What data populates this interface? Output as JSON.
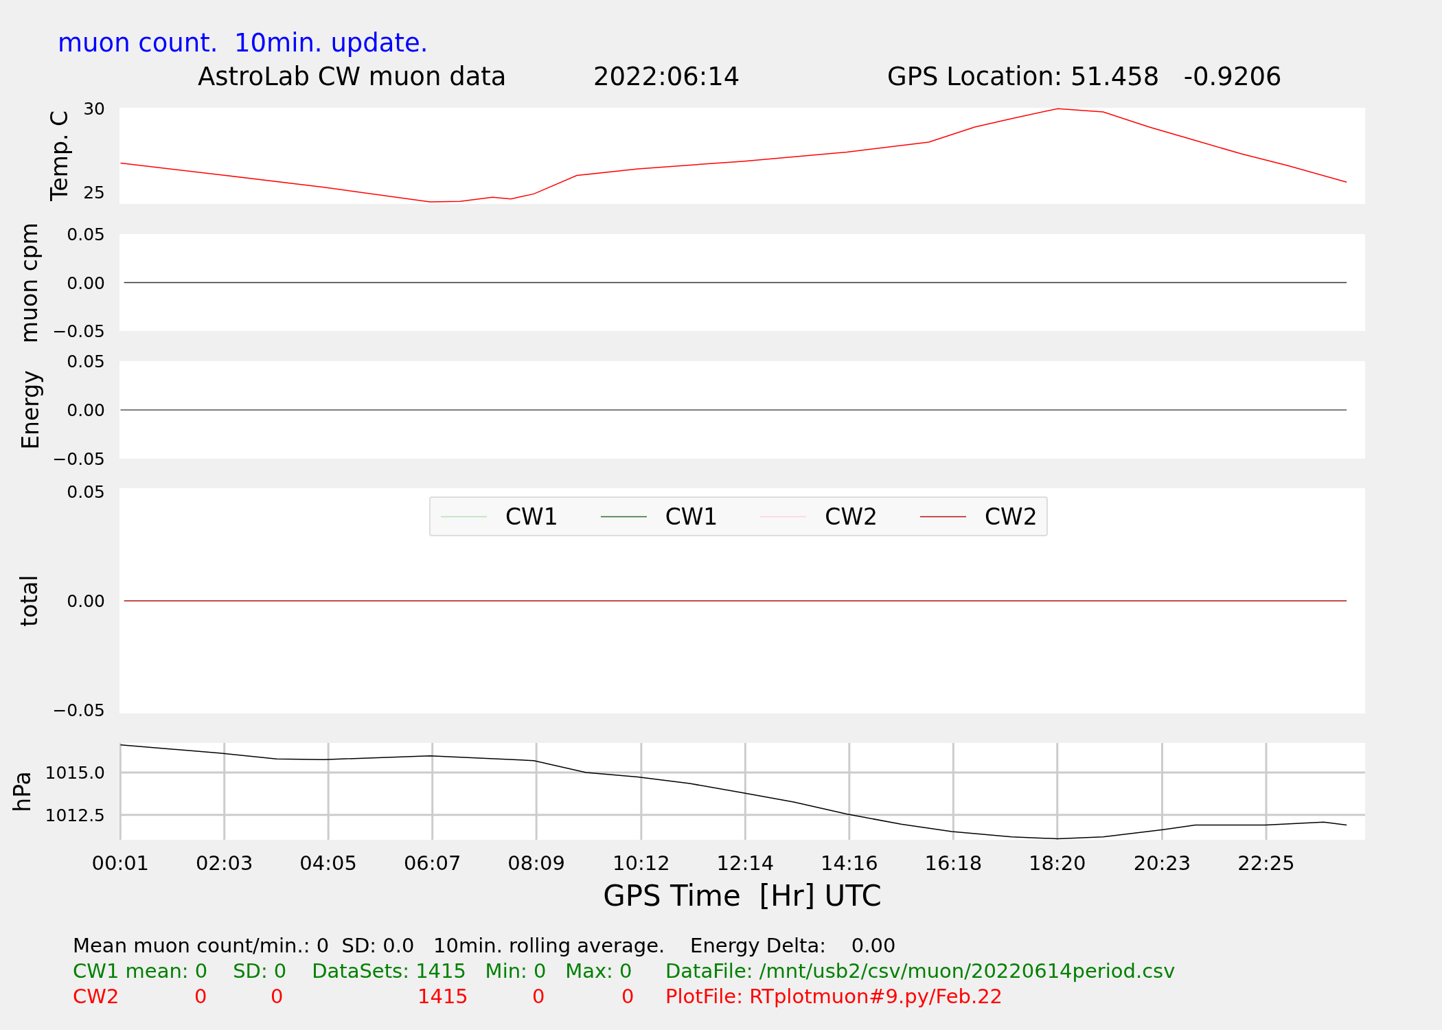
{
  "header": {
    "subtitle": "muon count.  10min. update.",
    "title": "AstroLab CW muon data",
    "date": "2022:06:14",
    "location": "GPS Location: 51.458   -0.9206"
  },
  "panels": [
    {
      "chart_data": {
        "type": "line",
        "ylabel": "Temp. C",
        "xlim": [
          0,
          24.35
        ],
        "ylim": [
          24.3,
          30.05
        ],
        "yticks": [
          {
            "value": 25,
            "label": "25"
          },
          {
            "value": 30,
            "label": "30"
          }
        ],
        "x": [
          0.02,
          1.96,
          4.0,
          6.07,
          6.66,
          7.29,
          7.65,
          8.1,
          8.94,
          10.13,
          12.18,
          14.22,
          15.82,
          16.72,
          17.44,
          18.34,
          19.23,
          20.13,
          21.03,
          21.93,
          22.83,
          23.99
        ],
        "series": [
          {
            "color": "#ff0000",
            "values": [
              26.74,
              26.05,
              25.3,
              24.42,
              24.45,
              24.7,
              24.6,
              24.9,
              26.0,
              26.4,
              26.85,
              27.4,
              28.0,
              28.9,
              29.4,
              30.0,
              29.8,
              28.9,
              28.1,
              27.3,
              26.6,
              25.6
            ]
          }
        ]
      }
    },
    {
      "chart_data": {
        "type": "line",
        "ylabel": "muon cpm",
        "xlim": [
          0,
          24.35
        ],
        "ylim": [
          -0.05,
          0.05
        ],
        "yticks": [
          {
            "value": 0.05,
            "label": "0.05"
          },
          {
            "value": 0,
            "label": "0.00"
          },
          {
            "value": -0.05,
            "label": "−0.05"
          }
        ],
        "x": [
          0.09,
          23.99
        ],
        "series": [
          {
            "color": "#333333",
            "values": [
              0,
              0
            ]
          }
        ]
      }
    },
    {
      "chart_data": {
        "type": "line",
        "ylabel": "Energy",
        "xlim": [
          0,
          24.35
        ],
        "ylim": [
          -0.05,
          0.05
        ],
        "yticks": [
          {
            "value": 0.05,
            "label": "0.05"
          },
          {
            "value": 0,
            "label": "0.00"
          },
          {
            "value": -0.05,
            "label": "−0.05"
          }
        ],
        "x": [
          0.02,
          23.99
        ],
        "series": [
          {
            "color": "#555555",
            "values": [
              0,
              0
            ]
          }
        ]
      }
    },
    {
      "chart_data": {
        "type": "line",
        "ylabel": "total",
        "xlim": [
          0,
          24.35
        ],
        "ylim": [
          -0.0515,
          0.0515
        ],
        "yticks": [
          {
            "value": 0.05,
            "label": "0.05"
          },
          {
            "value": 0,
            "label": "0.00"
          },
          {
            "value": -0.05,
            "label": "−0.05"
          }
        ],
        "x": [
          0.09,
          23.99
        ],
        "legend": true,
        "series": [
          {
            "name": "CW1",
            "color": "#b8ddb8",
            "values": [
              null,
              null
            ]
          },
          {
            "name": "CW1",
            "color": "#2e6b2e",
            "values": [
              null,
              null
            ]
          },
          {
            "name": "CW2",
            "color": "#ffd0d8",
            "values": [
              null,
              null
            ]
          },
          {
            "name": "CW2",
            "color": "#b01010",
            "values": [
              0,
              0
            ]
          }
        ]
      }
    },
    {
      "chart_data": {
        "type": "line",
        "ylabel": "hPa",
        "xlabel": "GPS Time  [Hr] UTC",
        "grid": true,
        "xlim": [
          0,
          24.35
        ],
        "ylim": [
          1011.03,
          1016.74
        ],
        "yticks": [
          {
            "value": 1015,
            "label": "1015.0"
          },
          {
            "value": 1012.5,
            "label": "1012.5"
          }
        ],
        "xticks": [
          {
            "value": 0.017,
            "label": "00:01"
          },
          {
            "value": 2.05,
            "label": "02:03"
          },
          {
            "value": 4.083,
            "label": "04:05"
          },
          {
            "value": 6.117,
            "label": "06:07"
          },
          {
            "value": 8.15,
            "label": "08:09"
          },
          {
            "value": 10.2,
            "label": "10:12"
          },
          {
            "value": 12.233,
            "label": "12:14"
          },
          {
            "value": 14.267,
            "label": "14:16"
          },
          {
            "value": 16.3,
            "label": "16:18"
          },
          {
            "value": 18.333,
            "label": "18:20"
          },
          {
            "value": 20.383,
            "label": "20:23"
          },
          {
            "value": 22.417,
            "label": "22:25"
          }
        ],
        "x": [
          0.02,
          1.96,
          3.07,
          4.0,
          6.07,
          8.1,
          9.12,
          10.13,
          11.15,
          12.18,
          13.18,
          14.22,
          15.28,
          16.27,
          17.44,
          18.34,
          19.23,
          20.4,
          21.03,
          22.4,
          23.54,
          23.99
        ],
        "series": [
          {
            "color": "#000000",
            "values": [
              1016.63,
              1016.14,
              1015.8,
              1015.76,
              1015.98,
              1015.7,
              1015.0,
              1014.73,
              1014.35,
              1013.8,
              1013.26,
              1012.55,
              1011.95,
              1011.52,
              1011.2,
              1011.09,
              1011.2,
              1011.63,
              1011.9,
              1011.9,
              1012.07,
              1011.9
            ]
          }
        ]
      }
    }
  ],
  "summary": {
    "line1": "Mean muon count/min.: 0  SD: 0.0   10min. rolling average.    Energy Delta:    0.00",
    "cw1": {
      "stats": "CW1 mean: 0    SD: 0    DataSets: 1415   Min: 0   Max: 0",
      "file": "DataFile: /mnt/usb2/csv/muon/20220614period.csv"
    },
    "cw2": {
      "cells": [
        "CW2",
        "0",
        "0",
        "1415",
        "0",
        "0"
      ],
      "file": "PlotFile: RTplotmuon#9.py/Feb.22"
    }
  }
}
